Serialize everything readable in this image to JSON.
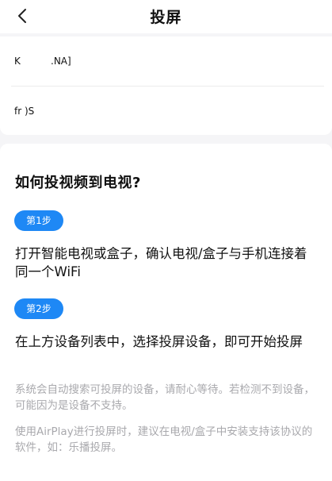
{
  "header": {
    "title": "投屏",
    "back_icon": "chevron-left-icon"
  },
  "devices": [
    {
      "name": "K          .NA]"
    },
    {
      "name": "fr )S"
    }
  ],
  "guide": {
    "title": "如何投视频到电视?",
    "steps": [
      {
        "badge": "第1步",
        "text": "打开智能电视或盒子，确认电视/盒子与手机连接着同一个WiFi"
      },
      {
        "badge": "第2步",
        "text": "在上方设备列表中，选择投屏设备，即可开始投屏"
      }
    ],
    "notes": [
      "系统会自动搜索可投屏的设备，请耐心等待。若检测不到设备，可能因为是设备不支持。",
      "使用AirPlay进行投屏时，建议在电视/盒子中安装支持该协议的软件，如：乐播投屏。"
    ]
  },
  "colors": {
    "accent": "#1e88f5",
    "note_text": "#a9a9ad",
    "background": "#f5f5f7"
  }
}
